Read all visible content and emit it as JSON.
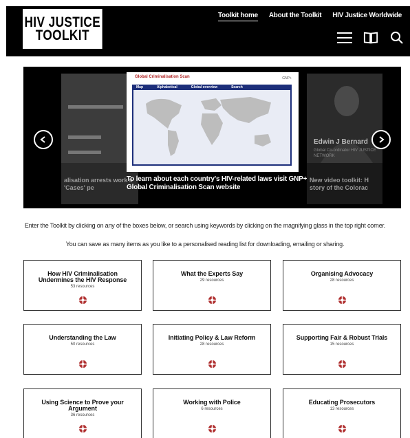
{
  "logo": {
    "line1": "HIV JUSTICE",
    "line2": "TOOLKIT"
  },
  "nav": [
    {
      "label": "Toolkit home"
    },
    {
      "label": "About the Toolkit"
    },
    {
      "label": "HIV Justice Worldwide"
    }
  ],
  "header_icons": [
    "menu-icon",
    "book-icon",
    "search-icon"
  ],
  "carousel": {
    "left_caption": "alisation arrests work's 'Cases' pe",
    "main_caption": "To learn about each country's HIV-related laws visit GNP+'s Global Criminalisation Scan website",
    "main_slide": {
      "brand": "Global Criminalisation Scan",
      "brand_right": "GNP+",
      "tabs": [
        "Map",
        "Alphabetical",
        "Global overview",
        "Search"
      ]
    },
    "right_name": "Edwin J Bernard",
    "right_role": "Global Co-ordinator HIV JUSTICE NETWORK",
    "right_caption": "New video toolkit: H story of the Colorac"
  },
  "intro": {
    "line1": "Enter the Toolkit by clicking on any of the boxes below, or search using keywords by clicking on the magnifying glass in the top right corner.",
    "line2": "You can save as many items as you like to a personalised reading list for downloading, emailing or sharing."
  },
  "tiles": [
    {
      "title": "How HIV Criminalisation Undermines the HIV Response",
      "count": "53 resources"
    },
    {
      "title": "What the Experts Say",
      "count": "29 resources"
    },
    {
      "title": "Organising Advocacy",
      "count": "28 resources"
    },
    {
      "title": "Understanding the Law",
      "count": "50 resources"
    },
    {
      "title": "Initiating Policy & Law Reform",
      "count": "28 resources"
    },
    {
      "title": "Supporting Fair & Robust Trials",
      "count": "15 resources"
    },
    {
      "title": "Using Science to Prove your Argument",
      "count": "36 resources"
    },
    {
      "title": "Working with Police",
      "count": "6 resources"
    },
    {
      "title": "Educating Prosecutors",
      "count": "13 resources"
    }
  ],
  "colors": {
    "header_bg": "#000000",
    "tile_icon": "#b03030"
  }
}
